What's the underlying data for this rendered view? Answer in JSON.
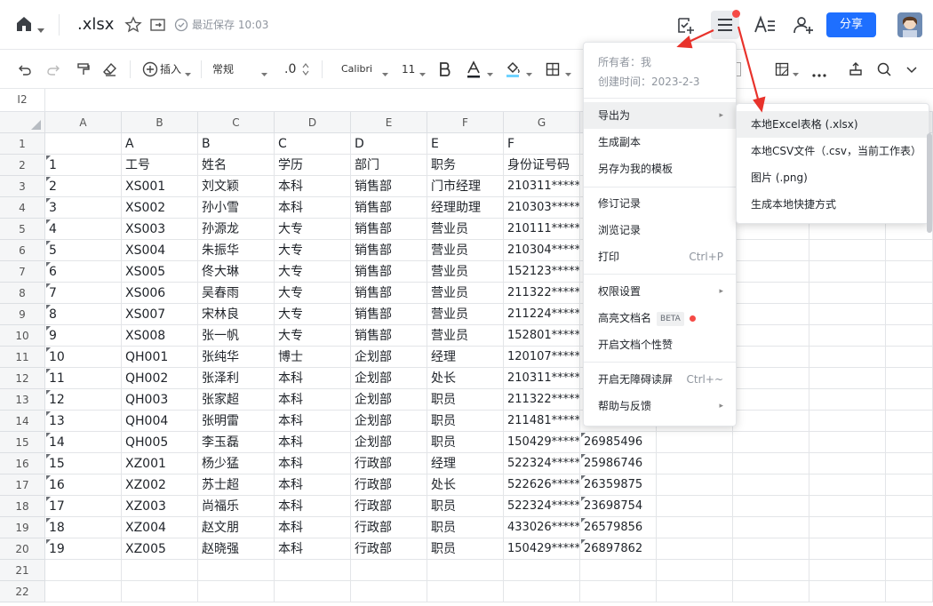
{
  "header": {
    "filename": ".xlsx",
    "save_status": "最近保存 10:03",
    "share_label": "分享",
    "accent": "#1e6fff",
    "notification_dot": "#f54a45"
  },
  "toolbar": {
    "insert_label": "插入",
    "format_label": "常规",
    "decimal_label": ".0",
    "font_name": "Calibri",
    "font_size": "11"
  },
  "formula_bar": {
    "cell_ref": "I2"
  },
  "sheet": {
    "columns": [
      "A",
      "B",
      "C",
      "D",
      "E",
      "F",
      "G"
    ],
    "row_numbers": [
      "1",
      "2",
      "3",
      "4",
      "5",
      "6",
      "7",
      "8",
      "9",
      "10",
      "11",
      "12",
      "13",
      "14",
      "15",
      "16",
      "17",
      "18",
      "19",
      "20",
      "21",
      "22"
    ],
    "rows": [
      [
        "",
        "A",
        "B",
        "C",
        "D",
        "E",
        "F",
        ""
      ],
      [
        "1",
        "工号",
        "姓名",
        "学历",
        "部门",
        "职务",
        "身份证号码",
        ""
      ],
      [
        "2",
        "XS001",
        "刘文颖",
        "本科",
        "销售部",
        "门市经理",
        "210311*****",
        ""
      ],
      [
        "3",
        "XS002",
        "孙小雪",
        "本科",
        "销售部",
        "经理助理",
        "210303*****",
        ""
      ],
      [
        "4",
        "XS003",
        "孙源龙",
        "大专",
        "销售部",
        "营业员",
        "210111*****",
        ""
      ],
      [
        "5",
        "XS004",
        "朱振华",
        "大专",
        "销售部",
        "营业员",
        "210304*****",
        ""
      ],
      [
        "6",
        "XS005",
        "佟大琳",
        "大专",
        "销售部",
        "营业员",
        "152123*****",
        ""
      ],
      [
        "7",
        "XS006",
        "吴春雨",
        "大专",
        "销售部",
        "营业员",
        "211322*****",
        ""
      ],
      [
        "8",
        "XS007",
        "宋林良",
        "大专",
        "销售部",
        "营业员",
        "211224*****",
        ""
      ],
      [
        "9",
        "XS008",
        "张一帆",
        "大专",
        "销售部",
        "营业员",
        "152801*****",
        ""
      ],
      [
        "10",
        "QH001",
        "张纯华",
        "博士",
        "企划部",
        "经理",
        "120107*****",
        ""
      ],
      [
        "11",
        "QH002",
        "张泽利",
        "本科",
        "企划部",
        "处长",
        "210311*****",
        ""
      ],
      [
        "12",
        "QH003",
        "张家超",
        "本科",
        "企划部",
        "职员",
        "211322*****",
        ""
      ],
      [
        "13",
        "QH004",
        "张明雷",
        "本科",
        "企划部",
        "职员",
        "211481*****",
        ""
      ],
      [
        "14",
        "QH005",
        "李玉磊",
        "本科",
        "企划部",
        "职员",
        "150429*****",
        "26985496"
      ],
      [
        "15",
        "XZ001",
        "杨少猛",
        "本科",
        "行政部",
        "经理",
        "522324*****",
        "25986746"
      ],
      [
        "16",
        "XZ002",
        "苏士超",
        "本科",
        "行政部",
        "处长",
        "522626*****",
        "26359875"
      ],
      [
        "17",
        "XZ003",
        "尚福乐",
        "本科",
        "行政部",
        "职员",
        "522324*****",
        "23698754"
      ],
      [
        "18",
        "XZ004",
        "赵文朋",
        "本科",
        "行政部",
        "职员",
        "433026*****",
        "26579856"
      ],
      [
        "19",
        "XZ005",
        "赵晓强",
        "本科",
        "行政部",
        "职员",
        "150429*****",
        "26897862"
      ],
      [
        "",
        "",
        "",
        "",
        "",
        "",
        "",
        ""
      ],
      [
        "",
        "",
        "",
        "",
        "",
        "",
        "",
        ""
      ]
    ]
  },
  "menu": {
    "owner": "所有者：我",
    "created": "创建时间：2023-2-3",
    "items": [
      {
        "label": "导出为",
        "extra": "▸"
      },
      {
        "label": "生成副本",
        "extra": ""
      },
      {
        "label": "另存为我的模板",
        "extra": ""
      },
      {
        "label": "修订记录",
        "extra": ""
      },
      {
        "label": "浏览记录",
        "extra": ""
      },
      {
        "label": "打印",
        "extra": "Ctrl+P"
      },
      {
        "label": "权限设置",
        "extra": "▸"
      },
      {
        "label": "高亮文档名",
        "extra": ""
      },
      {
        "label": "开启文档个性赞",
        "extra": ""
      },
      {
        "label": "开启无障碍读屏",
        "extra": "Ctrl+~"
      },
      {
        "label": "帮助与反馈",
        "extra": "▸"
      }
    ],
    "beta_label": "BETA"
  },
  "submenu": {
    "items": [
      "本地Excel表格 (.xlsx)",
      "本地CSV文件（.csv，当前工作表）",
      "图片 (.png)",
      "生成本地快捷方式"
    ]
  },
  "annotation_color": "#e8322b"
}
